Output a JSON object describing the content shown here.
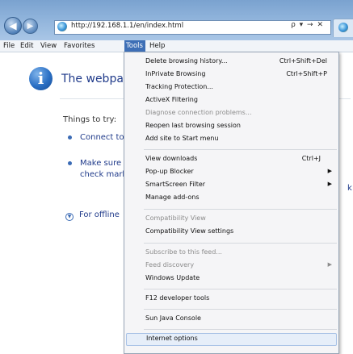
{
  "address_bar": {
    "url": "http://192.168.1.1/en/index.html",
    "actions": "ρ ▾ → ✕"
  },
  "menubar": {
    "items": [
      "File",
      "Edit",
      "View",
      "Favorites",
      "Tools",
      "Help"
    ],
    "active": "Tools"
  },
  "page": {
    "title": "The webpag",
    "things_to_try": "Things to try:",
    "suggestion_1": "Connect to",
    "suggestion_2_line1": "Make sure",
    "suggestion_2_line2": "check mark",
    "suggestion_2_tail": "k",
    "offline": "For offline"
  },
  "tools_menu": {
    "items": [
      {
        "label": "Delete browsing history...",
        "shortcut": "Ctrl+Shift+Del"
      },
      {
        "label": "InPrivate Browsing",
        "shortcut": "Ctrl+Shift+P"
      },
      {
        "label": "Tracking Protection..."
      },
      {
        "label": "ActiveX Filtering"
      },
      {
        "label": "Diagnose connection problems...",
        "disabled": true
      },
      {
        "label": "Reopen last browsing session"
      },
      {
        "label": "Add site to Start menu"
      },
      {
        "label": "View downloads",
        "shortcut": "Ctrl+J"
      },
      {
        "label": "Pop-up Blocker",
        "submenu": true
      },
      {
        "label": "SmartScreen Filter",
        "submenu": true
      },
      {
        "label": "Manage add-ons"
      },
      {
        "label": "Compatibility View",
        "disabled": true
      },
      {
        "label": "Compatibility View settings"
      },
      {
        "label": "Subscribe to this feed...",
        "disabled": true
      },
      {
        "label": "Feed discovery",
        "disabled": true,
        "submenu": true
      },
      {
        "label": "Windows Update"
      },
      {
        "label": "F12 developer tools"
      },
      {
        "label": "Sun Java Console"
      },
      {
        "label": "Internet options",
        "highlighted": true
      }
    ]
  },
  "colors": {
    "menu_highlight": "#e6eef9",
    "active_menu": "#3e6fb6",
    "link_text": "#1f3a8a"
  }
}
